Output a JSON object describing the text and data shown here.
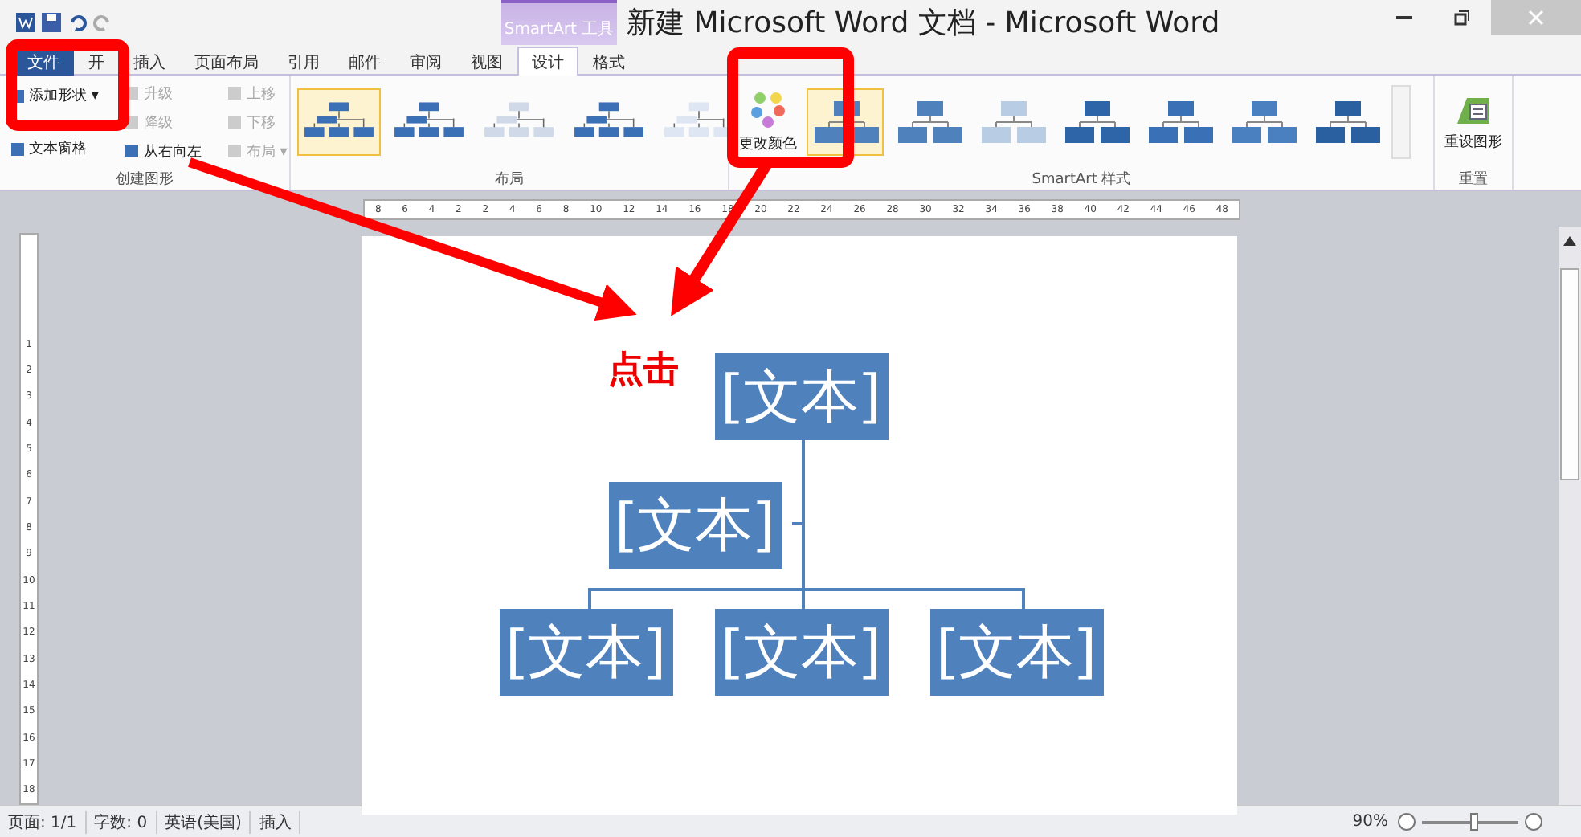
{
  "window": {
    "title": "新建 Microsoft Word 文档 - Microsoft Word",
    "context_tab": "SmartArt 工具"
  },
  "tabs": [
    {
      "label": "文件",
      "selected": false,
      "kind": "file"
    },
    {
      "label": "开",
      "selected": false,
      "kind": "tab"
    },
    {
      "label": "插入",
      "selected": false,
      "kind": "tab"
    },
    {
      "label": "页面布局",
      "selected": false,
      "kind": "tab"
    },
    {
      "label": "引用",
      "selected": false,
      "kind": "tab"
    },
    {
      "label": "邮件",
      "selected": false,
      "kind": "tab"
    },
    {
      "label": "审阅",
      "selected": false,
      "kind": "tab"
    },
    {
      "label": "视图",
      "selected": false,
      "kind": "tab"
    },
    {
      "label": "设计",
      "selected": true,
      "kind": "tab"
    },
    {
      "label": "格式",
      "selected": false,
      "kind": "tab"
    }
  ],
  "create_group": {
    "label": "创建图形",
    "buttons": [
      {
        "label": "添加形状 ▾",
        "disabled": false
      },
      {
        "label": "文本窗格",
        "disabled": false
      },
      {
        "label": "升级",
        "disabled": true
      },
      {
        "label": "降级",
        "disabled": true
      },
      {
        "label": "从右向左",
        "disabled": false
      },
      {
        "label": "上移",
        "disabled": true
      },
      {
        "label": "下移",
        "disabled": true
      },
      {
        "label": "布局 ▾",
        "disabled": true
      }
    ]
  },
  "layout_group": {
    "label": "布局",
    "layouts": [
      {
        "selected": true
      },
      {
        "selected": false
      },
      {
        "selected": false
      },
      {
        "selected": false
      },
      {
        "selected": false
      }
    ]
  },
  "style_group": {
    "label": "SmartArt 样式",
    "change_colors": "更改颜色",
    "styles": [
      {
        "selected": true,
        "color": "#4f81bd"
      },
      {
        "selected": false,
        "color": "#4f81bd"
      },
      {
        "selected": false,
        "color": "#b8cce4"
      },
      {
        "selected": false,
        "color": "#2e64a8"
      },
      {
        "selected": false,
        "color": "#3a70b5"
      },
      {
        "selected": false,
        "color": "#4a7fc0"
      },
      {
        "selected": false,
        "color": "#2a5fa0"
      }
    ]
  },
  "reset_group": {
    "label": "重置",
    "button": "重设图形"
  },
  "ruler_labels": [
    "8",
    "6",
    "4",
    "2",
    "2",
    "4",
    "6",
    "8",
    "10",
    "12",
    "14",
    "16",
    "18",
    "20",
    "22",
    "24",
    "26",
    "28",
    "30",
    "32",
    "34",
    "36",
    "38",
    "40",
    "42",
    "44",
    "46",
    "48"
  ],
  "vertical_ruler_labels": [
    "1",
    "2",
    "3",
    "4",
    "5",
    "6",
    "7",
    "8",
    "9",
    "10",
    "11",
    "12",
    "13",
    "14",
    "15",
    "16",
    "17",
    "18"
  ],
  "document": {
    "annotation": "点击",
    "nodes": [
      "[文本]",
      "[文本]",
      "[文本]",
      "[文本]",
      "[文本]"
    ]
  },
  "status_bar": {
    "page": "页面: 1/1",
    "words": "字数: 0",
    "language": "英语(美国)",
    "mode": "插入",
    "zoom": "90%",
    "zoom_level": {
      "level": 0.55
    }
  }
}
